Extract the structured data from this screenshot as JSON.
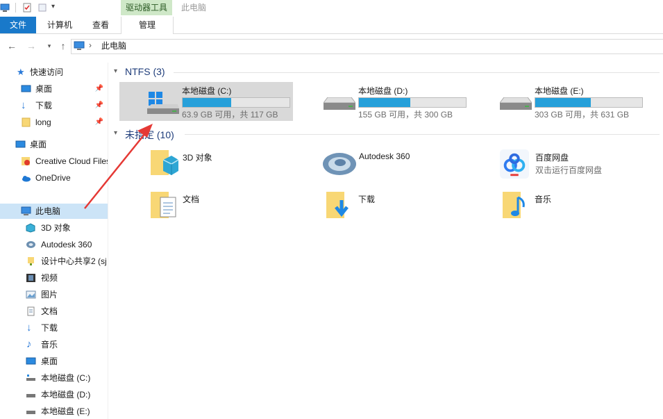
{
  "titlebar": {
    "context_tab": "驱动器工具",
    "title": "此电脑"
  },
  "ribbon": {
    "file": "文件",
    "computer": "计算机",
    "view": "查看",
    "manage": "管理"
  },
  "address": {
    "crumb": "此电脑"
  },
  "sidebar": {
    "quick_access": "快速访问",
    "desktop_pinned": "桌面",
    "downloads_pinned": "下载",
    "long": "long",
    "desktop": "桌面",
    "creative_cloud": "Creative Cloud Files",
    "onedrive": "OneDrive",
    "this_pc": "此电脑",
    "objects3d": "3D 对象",
    "autodesk": "Autodesk 360",
    "design_share": "设计中心共享2 (sj",
    "video": "视频",
    "pictures": "图片",
    "documents": "文档",
    "downloads": "下载",
    "music": "音乐",
    "desktop2": "桌面",
    "drive_c": "本地磁盘 (C:)",
    "drive_d": "本地磁盘 (D:)",
    "drive_e": "本地磁盘 (E:)"
  },
  "groups": {
    "ntfs": "NTFS (3)",
    "unspecified": "未指定 (10)"
  },
  "drives": [
    {
      "name": "本地磁盘 (C:)",
      "free": "63.9 GB 可用，共 117 GB",
      "used_fraction": 0.454
    },
    {
      "name": "本地磁盘 (D:)",
      "free": "155 GB 可用，共 300 GB",
      "used_fraction": 0.483
    },
    {
      "name": "本地磁盘 (E:)",
      "free": "303 GB 可用，共 631 GB",
      "used_fraction": 0.52
    }
  ],
  "folders": {
    "objects3d": "3D 对象",
    "autodesk": "Autodesk 360",
    "baidu": "百度网盘",
    "baidu_sub": "双击运行百度网盘",
    "documents": "文档",
    "downloads": "下载",
    "music": "音乐"
  }
}
